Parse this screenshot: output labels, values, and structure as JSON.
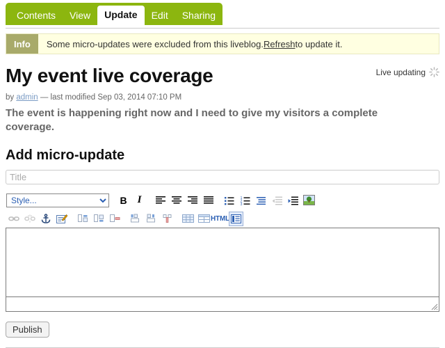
{
  "tabs": [
    {
      "label": "Contents",
      "active": false
    },
    {
      "label": "View",
      "active": false
    },
    {
      "label": "Update",
      "active": true
    },
    {
      "label": "Edit",
      "active": false
    },
    {
      "label": "Sharing",
      "active": false
    }
  ],
  "info": {
    "badge": "Info",
    "message_before": "Some micro-updates were excluded from this liveblog. ",
    "link": "Refresh",
    "message_after": " to update it."
  },
  "document": {
    "title": "My event live coverage",
    "live_updating_label": "Live updating",
    "spinner_icon": "loading-spinner-icon",
    "byline_prefix": "by ",
    "author": "admin",
    "byline_suffix": " — last modified Sep 03, 2014 07:10 PM",
    "description": "The event is happening right now and I need to give my visitors a complete coverage."
  },
  "form": {
    "section_title": "Add micro-update",
    "title_placeholder": "Title",
    "title_value": "",
    "publish_label": "Publish"
  },
  "editor": {
    "style_select_value": "Style...",
    "style_options": [
      "Style..."
    ],
    "toolbar_row1": [
      {
        "name": "bold-icon",
        "label": "B"
      },
      {
        "name": "italic-icon",
        "label": "I"
      },
      {
        "name": "align-left-icon",
        "label": ""
      },
      {
        "name": "align-center-icon",
        "label": ""
      },
      {
        "name": "align-right-icon",
        "label": ""
      },
      {
        "name": "align-justify-icon",
        "label": ""
      },
      {
        "name": "bulleted-list-icon",
        "label": ""
      },
      {
        "name": "numbered-list-icon",
        "label": ""
      },
      {
        "name": "blockquote-icon",
        "label": ""
      },
      {
        "name": "outdent-icon",
        "label": ""
      },
      {
        "name": "indent-icon",
        "label": ""
      },
      {
        "name": "insert-image-icon",
        "label": ""
      }
    ],
    "toolbar_row2": [
      {
        "name": "insert-link-icon",
        "label": ""
      },
      {
        "name": "unlink-icon",
        "label": ""
      },
      {
        "name": "anchor-icon",
        "label": ""
      },
      {
        "name": "edit-properties-icon",
        "label": ""
      },
      {
        "name": "insert-row-before-icon",
        "label": ""
      },
      {
        "name": "insert-row-after-icon",
        "label": ""
      },
      {
        "name": "delete-row-icon",
        "label": ""
      },
      {
        "name": "insert-column-before-icon",
        "label": ""
      },
      {
        "name": "insert-column-after-icon",
        "label": ""
      },
      {
        "name": "delete-column-icon",
        "label": ""
      },
      {
        "name": "insert-table-icon",
        "label": ""
      },
      {
        "name": "table-properties-icon",
        "label": ""
      },
      {
        "name": "html-source-icon",
        "label": "HTML"
      },
      {
        "name": "maximize-editor-icon",
        "label": ""
      }
    ],
    "content": ""
  },
  "colors": {
    "tab_green": "#8cb60f",
    "info_badge": "#a8aa6a",
    "info_background": "#ffffe1",
    "link_blue": "#7a9bc4",
    "editor_accent": "#2b5fb3"
  }
}
